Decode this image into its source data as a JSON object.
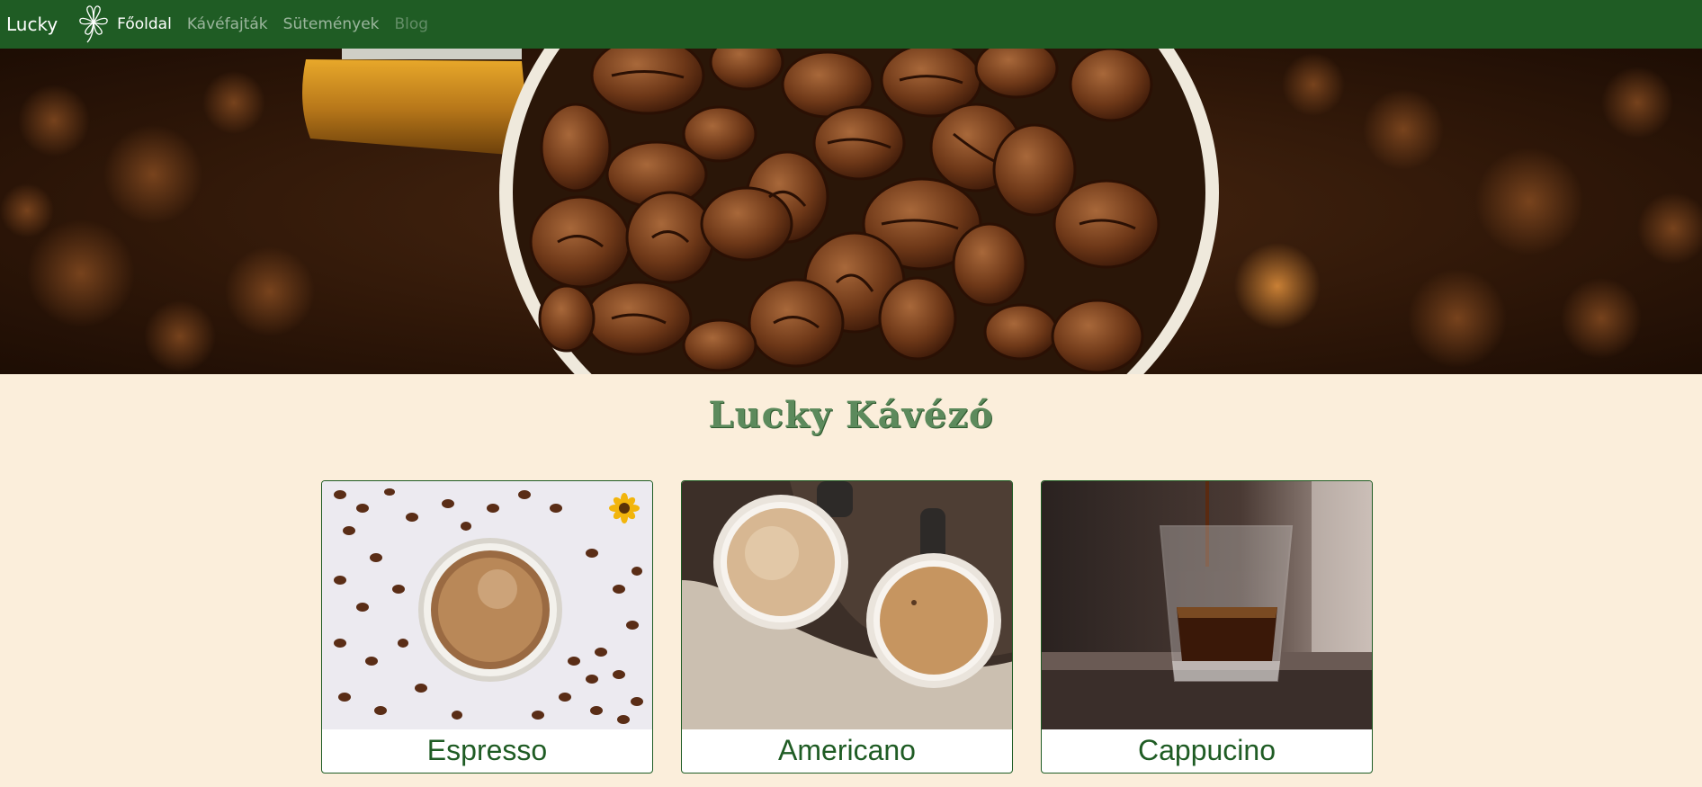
{
  "navbar": {
    "brand": "Lucky",
    "links": [
      {
        "label": "Főoldal",
        "state": "active"
      },
      {
        "label": "Kávéfajták",
        "state": "normal"
      },
      {
        "label": "Sütemények",
        "state": "normal"
      },
      {
        "label": "Blog",
        "state": "disabled"
      }
    ]
  },
  "hero": {
    "image": "coffee-beans-in-cup-photo"
  },
  "main": {
    "title": "Lucky Kávézó"
  },
  "cards": [
    {
      "title": "Espresso",
      "image": "espresso-cup-with-scattered-beans-photo"
    },
    {
      "title": "Americano",
      "image": "two-coffee-cups-top-view-photo"
    },
    {
      "title": "Cappucino",
      "image": "espresso-pouring-into-glass-photo"
    }
  ],
  "colors": {
    "navbar_bg": "#1f5c24",
    "page_bg": "#fbeedb",
    "accent_green": "#1f5c24",
    "title_green": "#5c8a5c"
  }
}
